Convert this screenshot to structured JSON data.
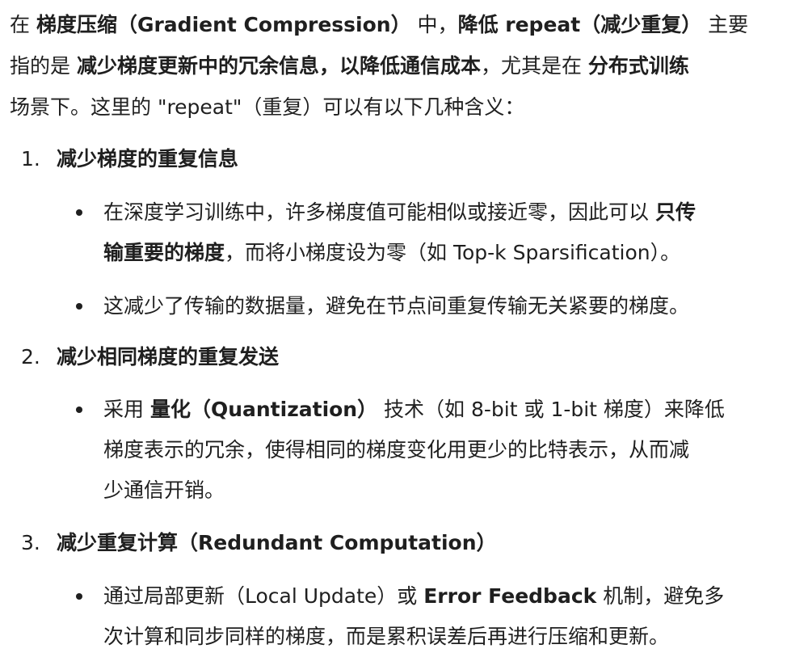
{
  "intro": {
    "l1": {
      "a": "在 ",
      "b": "梯度压缩（Gradient Compression）",
      "c": " 中，",
      "d": "降低 repeat（减少重复）",
      "e": " 主要"
    },
    "l2": {
      "a": "指的是 ",
      "b": "减少梯度更新中的冗余信息，以降低通信成本",
      "c": "，尤其是在 ",
      "d": "分布式训练"
    },
    "l3": "场景下。这里的 \"repeat\"（重复）可以有以下几种含义："
  },
  "items": [
    {
      "number": "1.",
      "heading": "减少梯度的重复信息",
      "bullets": {
        "b1": {
          "a": "在深度学习训练中，许多梯度值可能相似或接近零，因此可以 ",
          "b": "只传",
          "c": "输重要的梯度",
          "d": "，而将小梯度设为零（如 Top-k Sparsification）。"
        },
        "b2": "这减少了传输的数据量，避免在节点间重复传输无关紧要的梯度。"
      }
    },
    {
      "number": "2.",
      "heading": "减少相同梯度的重复发送",
      "bullets": {
        "b1": {
          "a": "采用 ",
          "b": "量化（Quantization）",
          "c": " 技术（如 8-bit 或 1-bit 梯度）来降低",
          "d": "梯度表示的冗余，使得相同的梯度变化用更少的比特表示，从而减",
          "e": "少通信开销。"
        }
      }
    },
    {
      "number": "3.",
      "heading": "减少重复计算（Redundant Computation）",
      "bullets": {
        "b1": {
          "a": "通过局部更新（Local Update）或 ",
          "b": "Error Feedback",
          "c": " 机制，避免多",
          "d": "次计算和同步同样的梯度，而是累积误差后再进行压缩和更新。"
        }
      }
    }
  ]
}
